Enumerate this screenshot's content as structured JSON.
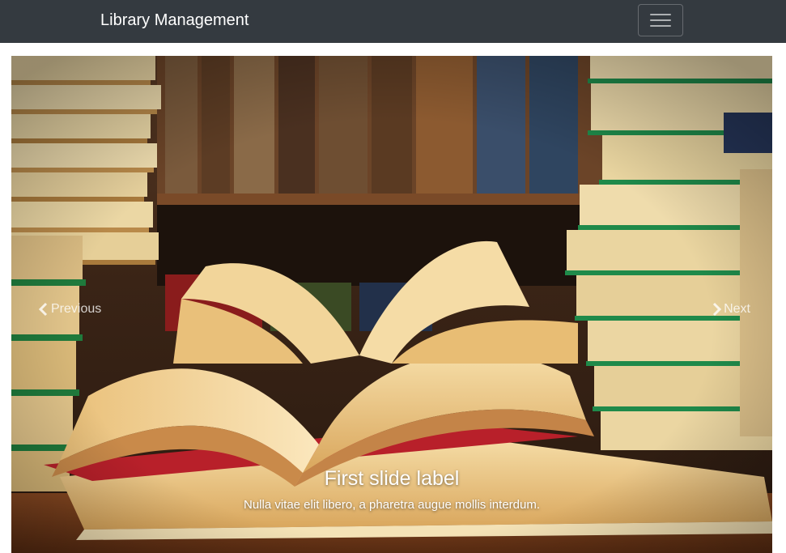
{
  "navbar": {
    "brand": "Library Management",
    "toggler_icon": "hamburger-menu-icon",
    "background": "#343a40"
  },
  "carousel": {
    "slide": {
      "image_subject": "open books on a wooden table in front of stacked books and library shelves",
      "caption_title": "First slide label",
      "caption_text": "Nulla vitae elit libero, a pharetra augue mollis interdum."
    },
    "controls": {
      "previous_label": "Previous",
      "previous_icon": "chevron-left-icon",
      "next_label": "Next",
      "next_icon": "chevron-right-icon"
    }
  }
}
